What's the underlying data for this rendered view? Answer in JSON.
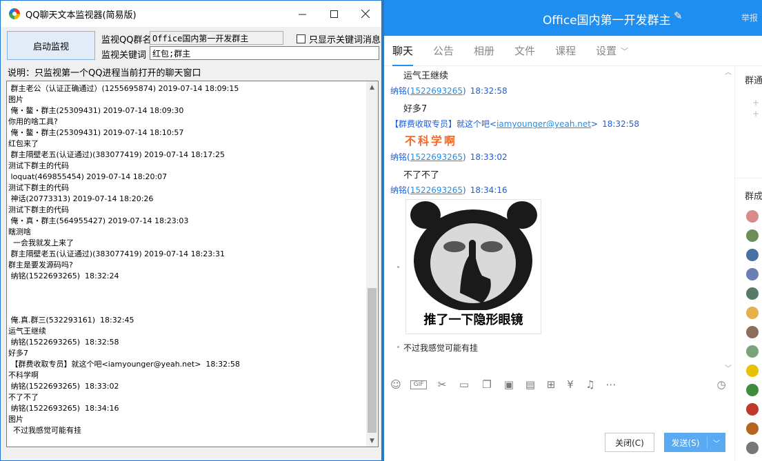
{
  "monitor": {
    "title": "QQ聊天文本监视器(简易版)",
    "start_label": "启动监视",
    "group_label": "监视QQ群名",
    "group_value": "Office国内第一开发群主",
    "keyword_label": "监视关键词",
    "keyword_value": "红包;群主",
    "only_keyword_label": "只显示关键词消息",
    "note": "说明：只监视第一个QQ进程当前打开的聊天窗口",
    "log": [
      " 群主老公（认证正确通过）(1255695874) 2019-07-14 18:09:15",
      "图片",
      " 俺・鳌・群主(25309431) 2019-07-14 18:09:30",
      "你用的啥工具?",
      " 俺・鳌・群主(25309431) 2019-07-14 18:10:57",
      "红包来了",
      " 群主隔壁老五(认证通过)(383077419) 2019-07-14 18:17:25",
      "测试下群主的代码",
      " loquat(469855454) 2019-07-14 18:20:07",
      "测试下群主的代码",
      " 神话(20773313) 2019-07-14 18:20:26",
      "测试下群主的代码",
      " 俺・真・群主(564955427) 2019-07-14 18:23:03",
      "瞎测啥",
      "  一会我就发上来了",
      " 群主隔壁老五(认证通过)(383077419) 2019-07-14 18:23:31",
      "群主是要发源码吗?",
      " 纳铭(1522693265)  18:32:24",
      "",
      "",
      "",
      " 俺.真.群三(532293161)  18:32:45",
      "运气王继续",
      " 纳铭(1522693265)  18:32:58",
      "好多7",
      " 【群费收取专员】就这个吧<iamyounger@yeah.net>  18:32:58",
      "不科学啊",
      " 纳铭(1522693265)  18:33:02",
      "不了不了",
      " 纳铭(1522693265)  18:34:16",
      "图片",
      "  不过我感觉可能有挂"
    ]
  },
  "qq": {
    "title": "Office国内第一开发群主",
    "report": "举报",
    "tabs": [
      "聊天",
      "公告",
      "相册",
      "文件",
      "课程",
      "设置"
    ],
    "messages": {
      "m0_text": "运气王继续",
      "m1_name": "纳铭(",
      "m1_num": "1522693265",
      "m1_close": ")",
      "m1_time": "18:32:58",
      "m1_text": "好多7",
      "m2_role": "【群费收取专员】",
      "m2_name": "就这个吧<",
      "m2_email": "iamyounger@yeah.net",
      "m2_close": ">",
      "m2_time": "18:32:58",
      "m2_text": "不科学啊",
      "m3_name": "纳铭(",
      "m3_num": "1522693265",
      "m3_close": ")",
      "m3_time": "18:33:02",
      "m3_text": "不了不了",
      "m4_name": "纳铭(",
      "m4_num": "1522693265",
      "m4_close": ")",
      "m4_time": "18:34:16",
      "sticker_caption": "推了一下隐形眼镜",
      "m5_text": "不过我感觉可能有挂"
    },
    "close_label": "关闭(C)",
    "send_label": "发送(S)",
    "side_notice": "群通",
    "side_members": "群成"
  }
}
